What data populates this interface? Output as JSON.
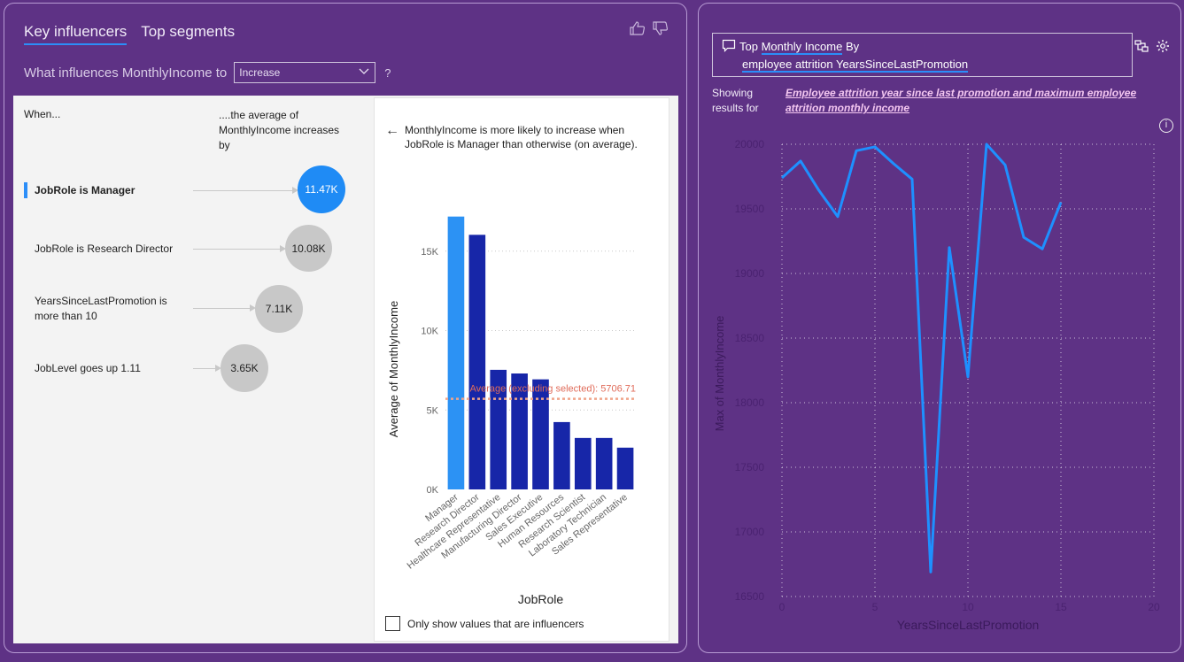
{
  "left_visual": {
    "tabs": [
      {
        "label": "Key influencers",
        "active": true
      },
      {
        "label": "Top segments",
        "active": false
      }
    ],
    "question_prefix": "What influences MonthlyIncome to",
    "dropdown_value": "Increase",
    "question_mark": "?",
    "col_when": "When...",
    "col_effect": "....the average of MonthlyIncome increases by",
    "influencers": [
      {
        "label": "JobRole is Manager",
        "value": "11.47K",
        "selected": true
      },
      {
        "label": "JobRole is Research Director",
        "value": "10.08K",
        "selected": false
      },
      {
        "label": "YearsSinceLastPromotion is more than 10",
        "value": "7.11K",
        "selected": false
      },
      {
        "label": "JobLevel goes up 1.11",
        "value": "3.65K",
        "selected": false
      }
    ],
    "detail": {
      "back_arrow": "←",
      "text": "MonthlyIncome is more likely to increase when JobRole is Manager than otherwise (on average).",
      "only_influencers_label": "Only show values that are influencers"
    }
  },
  "colors": {
    "background": "#5e3285",
    "selected_bar": "#2c92f4",
    "bar": "#1726a8",
    "avg_line": "#f0a48a",
    "line": "#1e90ff"
  },
  "chart_data": [
    {
      "type": "bar",
      "categories": [
        "Manager",
        "Research Director",
        "Healthcare Representative",
        "Manufacturing Director",
        "Sales Executive",
        "Human Resources",
        "Research Scientist",
        "Laboratory Technician",
        "Sales Representative"
      ],
      "values": [
        17180,
        16030,
        7530,
        7300,
        6930,
        4240,
        3240,
        3240,
        2630
      ],
      "highlight_index": 0,
      "xlabel": "JobRole",
      "ylabel": "Average of MonthlyIncome",
      "yticks": [
        0,
        5000,
        10000,
        15000
      ],
      "ytick_labels": [
        "0K",
        "5K",
        "10K",
        "15K"
      ],
      "ylim": [
        0,
        18500
      ],
      "reference_line": {
        "value": 5706.71,
        "label": "Average (excluding selected): 5706.71"
      },
      "grid": true
    },
    {
      "type": "line",
      "x": [
        0,
        1,
        2,
        3,
        4,
        5,
        6,
        7,
        8,
        9,
        10,
        11,
        12,
        13,
        14,
        15
      ],
      "y": [
        19740,
        19870,
        19640,
        19440,
        19950,
        19980,
        19850,
        19730,
        16690,
        19200,
        18200,
        20000,
        19840,
        19280,
        19190,
        19550
      ],
      "xlabel": "YearsSinceLastPromotion",
      "ylabel": "Max of MonthlyIncome",
      "xlim": [
        0,
        20
      ],
      "ylim": [
        16500,
        20000
      ],
      "xticks": [
        0,
        5,
        10,
        15,
        20
      ],
      "yticks": [
        16500,
        17000,
        17500,
        18000,
        18500,
        19000,
        19500,
        20000
      ],
      "grid": true
    }
  ],
  "right_visual": {
    "qa_line1_prefix": "Top ",
    "qa_line1_term": "Monthly Income",
    "qa_line1_suffix": " By",
    "qa_line2": "employee attrition YearsSinceLastPromotion",
    "showing_label": "Showing results for",
    "restatement": "Employee attrition year since last promotion and maximum employee attrition monthly income",
    "info": "i"
  }
}
